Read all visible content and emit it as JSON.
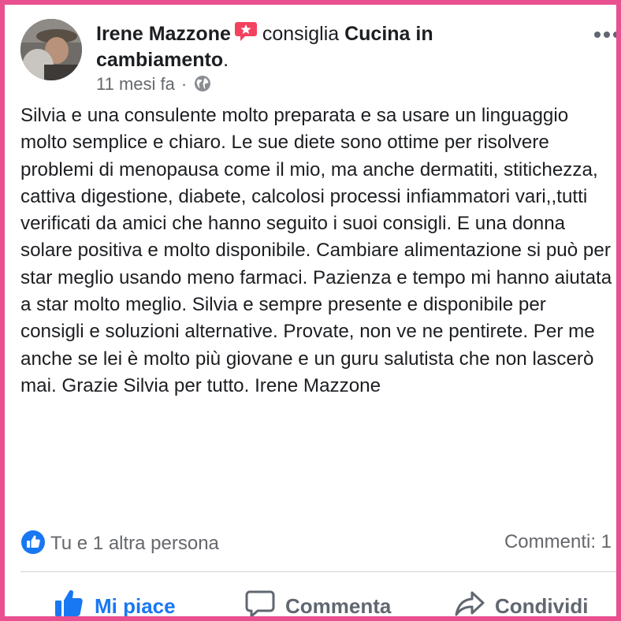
{
  "post": {
    "author": "Irene Mazzone",
    "verb": "consiglia",
    "page_name": "Cucina in cambiamento",
    "period": ".",
    "time": "11 mesi fa",
    "separator": "·",
    "text": "Silvia e una consulente molto preparata e sa usare un linguaggio molto semplice e chiaro. Le sue diete sono ottime per risolvere problemi di menopausa come il mio, ma anche dermatiti, stitichezza, cattiva digestione, diabete, calcolosi processi infiammatori vari,,tutti verificati da amici che hanno seguito i suoi consigli. E una donna solare positiva e molto disponibile. Cambiare alimentazione si può per star meglio usando meno farmaci. Pazienza e tempo mi hanno aiutata a star molto meglio. Silvia e sempre presente e disponibile per consigli e soluzioni alternative. Provate, non ve ne pentirete. Per me anche se lei è molto più giovane e un guru salutista che non lascerò mai. Grazie Silvia per tutto. Irene Mazzone"
  },
  "reactions": {
    "summary": "Tu e 1 altra persona",
    "comments": "Commenti: 1"
  },
  "actions": {
    "like": "Mi piace",
    "comment": "Commenta",
    "share": "Condividi"
  },
  "icons": {
    "recommend_badge": "speech-bubble-star-icon",
    "audience": "globe-icon",
    "more": "more-options-icon",
    "reaction": "thumbs-up-reaction-icon",
    "like": "thumbs-up-icon",
    "comment": "speech-bubble-icon",
    "share": "share-arrow-icon"
  },
  "colors": {
    "frame": "#e9508f",
    "accent": "#1877f2",
    "badge": "#f3425f",
    "secondary_text": "#65676b"
  }
}
